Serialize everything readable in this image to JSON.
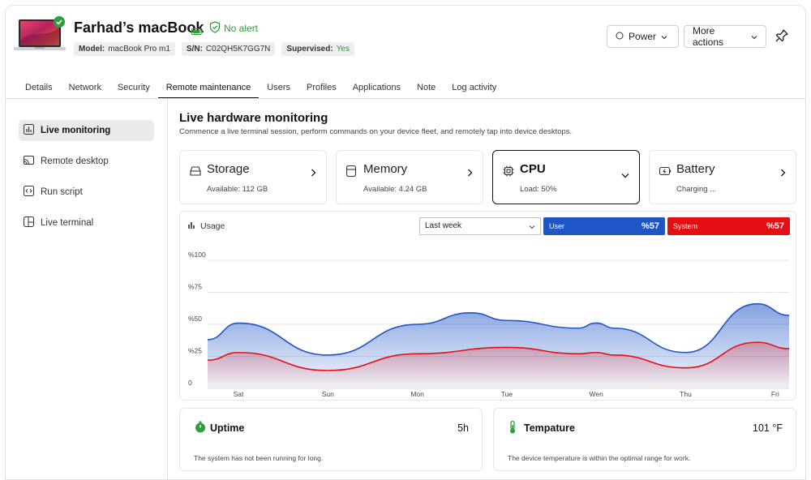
{
  "device": {
    "name": "Farhad’s macBook",
    "alert": "No alert",
    "chips": [
      {
        "label": "Model:",
        "value": "macBook Pro m1"
      },
      {
        "label": "S/N:",
        "value": "C02QH5K7GG7N"
      },
      {
        "label": "Supervised:",
        "value": "Yes"
      }
    ]
  },
  "actions": {
    "power": "Power",
    "more": "More actions"
  },
  "tabs": [
    "Details",
    "Network",
    "Security",
    "Remote maintenance",
    "Users",
    "Profiles",
    "Applications",
    "Note",
    "Log activity"
  ],
  "active_tab": "Remote maintenance",
  "sidebar": {
    "items": [
      {
        "label": "Live monitoring",
        "icon": "chart-bars-icon"
      },
      {
        "label": "Remote desktop",
        "icon": "cast-icon"
      },
      {
        "label": "Run script",
        "icon": "code-icon"
      },
      {
        "label": "Live terminal",
        "icon": "terminal-icon"
      }
    ]
  },
  "main": {
    "title": "Live hardware monitoring",
    "subtitle": "Commence a live terminal session, perform commands on your device fleet, and remotely tap into device desktops."
  },
  "cards": [
    {
      "name": "Storage",
      "detail": "Available: 112 GB",
      "icon": "drive-icon"
    },
    {
      "name": "Memory",
      "detail": "Available: 4.24 GB",
      "icon": "memory-icon"
    },
    {
      "name": "CPU",
      "detail": "Load: 50%",
      "icon": "chip-icon"
    },
    {
      "name": "Battery",
      "detail": "Charging ...",
      "icon": "battery-icon"
    }
  ],
  "usage": {
    "label": "Usage",
    "period": "Last week",
    "user": {
      "label": "User",
      "value": "%57"
    },
    "system": {
      "label": "System",
      "value": "%57"
    }
  },
  "colors": {
    "user": "#1f55c7",
    "system": "#e30f13",
    "ok": "#2e9d3c"
  },
  "chart_data": {
    "type": "area",
    "categories": [
      "Sat",
      "Sun",
      "Mon",
      "Tue",
      "Wen",
      "Thu",
      "Fri"
    ],
    "y_ticks": [
      "0",
      "%25",
      "%50",
      "%75",
      "%100"
    ],
    "ylim": [
      0,
      100
    ],
    "series": [
      {
        "name": "User",
        "x": [
          -0.33,
          0,
          1,
          2,
          2.6,
          3,
          3.8,
          4,
          4.2,
          5,
          5.8,
          6.2
        ],
        "values": [
          38,
          51,
          26,
          50,
          59,
          53,
          47,
          51,
          47,
          28,
          66,
          57
        ]
      },
      {
        "name": "System",
        "x": [
          -0.33,
          0,
          1,
          2,
          3,
          3.8,
          4,
          4.2,
          5,
          5.8,
          6.2
        ],
        "values": [
          22,
          28,
          14,
          27,
          32,
          27,
          28,
          26,
          16,
          36,
          31
        ]
      }
    ]
  },
  "stats": [
    {
      "name": "Uptime",
      "value": "5h",
      "desc": "The system has not been running for long.",
      "icon": "stopwatch-icon"
    },
    {
      "name": "Tempature",
      "value": "101 °F",
      "desc": "The device temperature is within the optimal range for work.",
      "icon": "thermometer-icon"
    }
  ]
}
